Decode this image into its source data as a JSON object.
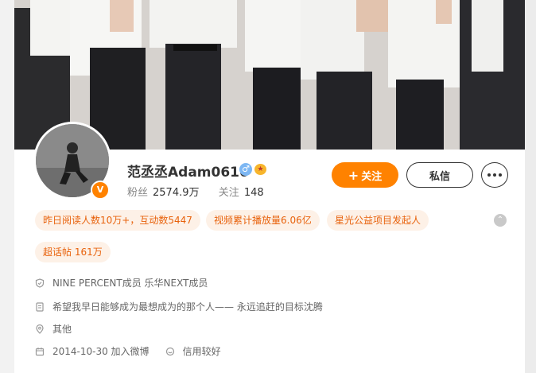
{
  "profile": {
    "name": "范丞丞Adam0616",
    "verified_badge": "V",
    "gender_icon": "male-icon",
    "gender_glyph": "♂",
    "emoji_glyph": "★",
    "stats": {
      "fans_label": "粉丝",
      "fans_value": "2574.9万",
      "follow_label": "关注",
      "follow_value": "148"
    }
  },
  "actions": {
    "follow_plus": "+",
    "follow_label": "关注",
    "message_label": "私信"
  },
  "tags": [
    "昨日阅读人数10万+，互动数5447",
    "视频累计播放量6.06亿",
    "星光公益项目发起人",
    "超话帖 161万"
  ],
  "collapse_glyph": "⌃",
  "info": {
    "identity": "NINE PERCENT成员 乐华NEXT成员",
    "bio": "希望我早日能够成为最想成为的那个人—— 永远追赶的目标沈腾",
    "location": "其他",
    "joined": "2014-10-30 加入微博",
    "credit": "信用较好"
  },
  "colors": {
    "accent": "#ff8200",
    "tag_bg": "#fdf1e7",
    "tag_text": "#e8620c"
  }
}
